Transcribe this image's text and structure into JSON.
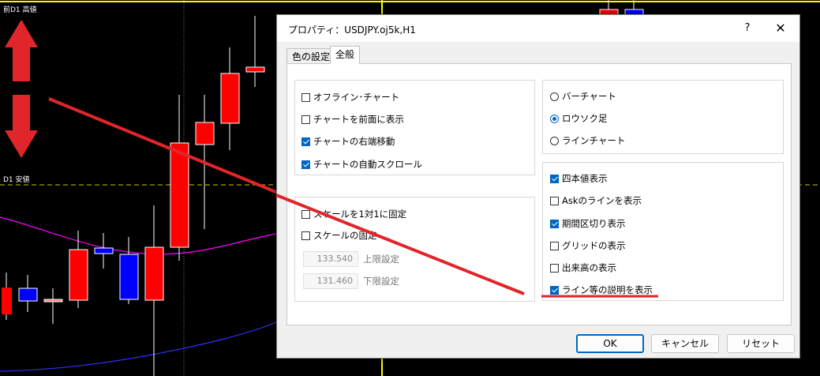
{
  "chart": {
    "prev_high_label": "前D1 高値",
    "d1_label": "D1 安値",
    "colors": {
      "background": "#000000",
      "bull": "#ff0000",
      "bear": "#0000ff",
      "yellow_line": "#ffff00",
      "grid": "#cccc00",
      "magenta_ma": "#ff00ff",
      "blue_ma": "#2828ff",
      "annotation_red": "#e0262a"
    }
  },
  "dialog": {
    "title": "プロパティ：USDJPY.oj5k,H1",
    "help_glyph": "?",
    "close_glyph": "✕",
    "tabs": [
      {
        "label": "色の設定",
        "active": false
      },
      {
        "label": "全般",
        "active": true
      }
    ],
    "chart_options": [
      {
        "label": "オフライン･チャート",
        "checked": false
      },
      {
        "label": "チャートを前面に表示",
        "checked": false
      },
      {
        "label": "チャートの右端移動",
        "checked": true
      },
      {
        "label": "チャートの自動スクロール",
        "checked": true
      }
    ],
    "scale_options": [
      {
        "label": "スケールを1対1に固定",
        "checked": false
      },
      {
        "label": "スケールの固定",
        "checked": false
      }
    ],
    "scale_max": {
      "value": "133.540",
      "label": "上限設定"
    },
    "scale_min": {
      "value": "131.460",
      "label": "下限設定"
    },
    "chart_types": [
      {
        "label": "バーチャート",
        "checked": false
      },
      {
        "label": "ロウソク足",
        "checked": true
      },
      {
        "label": "ラインチャート",
        "checked": false
      }
    ],
    "display_options": [
      {
        "label": "四本値表示",
        "checked": true
      },
      {
        "label": "Askのラインを表示",
        "checked": false
      },
      {
        "label": "期間区切り表示",
        "checked": true
      },
      {
        "label": "グリッドの表示",
        "checked": false
      },
      {
        "label": "出来高の表示",
        "checked": false
      },
      {
        "label": "ライン等の説明を表示",
        "checked": true
      }
    ],
    "buttons": {
      "ok": "OK",
      "cancel": "キャンセル",
      "reset": "リセット"
    }
  }
}
